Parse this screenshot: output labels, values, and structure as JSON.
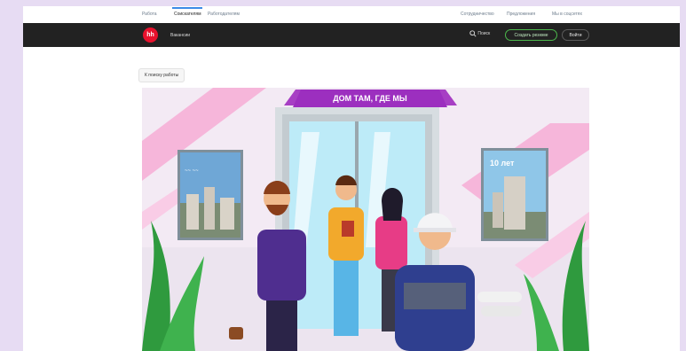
{
  "topnav": {
    "links": [
      {
        "label": "Работа"
      },
      {
        "label": "Соискателям"
      },
      {
        "label": "Работодателям"
      }
    ],
    "right_links": [
      {
        "label": "Сотрудничество"
      },
      {
        "label": "Предложения"
      },
      {
        "label": "Мы в соцсетях"
      }
    ]
  },
  "navbar": {
    "logo_text": "hh",
    "jobs_label": "Вакансии",
    "search_label": "Поиск",
    "create_resume_label": "Создать резюме",
    "login_label": "Войти"
  },
  "back_chip": {
    "label": "К поиску работы"
  },
  "banner": {
    "headline": "ДОМ ТАМ, ГДЕ МЫ",
    "poster_right_text": "10 лет"
  },
  "colors": {
    "navbar_bg": "#222222",
    "logo_red": "#e8112d",
    "accent_pink": "#d63da5",
    "create_resume_green": "#4cb84c"
  }
}
